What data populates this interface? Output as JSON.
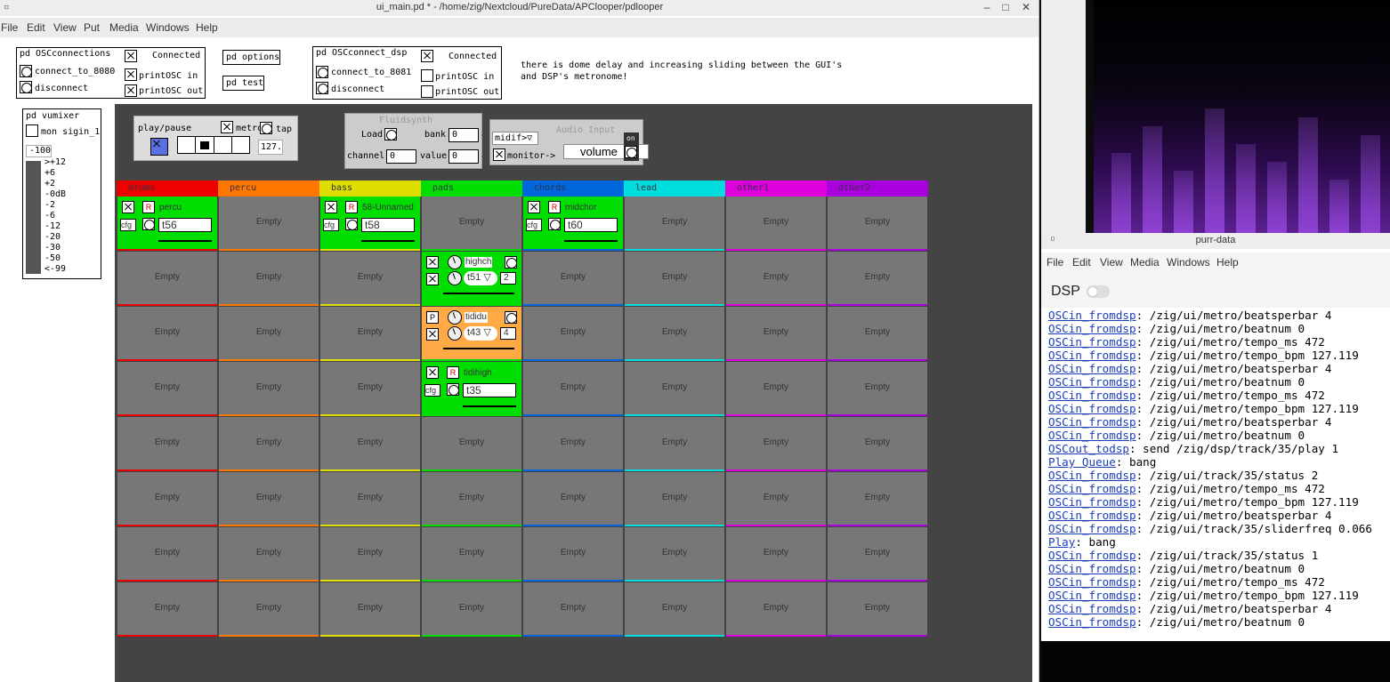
{
  "main_window": {
    "title": "ui_main.pd * - /home/zig/Nextcloud/PureData/APClooper/pdlooper",
    "menu": [
      "File",
      "Edit",
      "View",
      "Put",
      "Media",
      "Windows",
      "Help"
    ]
  },
  "osc_connections": {
    "name": "pd OSCconnections",
    "status": "Connected",
    "connect": "connect_to_8080",
    "disconnect": "disconnect",
    "print_in": "printOSC in",
    "print_out": "printOSC out"
  },
  "osc_connect_dsp": {
    "name": "pd OSCconnect_dsp",
    "status": "Connected",
    "connect": "connect_to_8081",
    "disconnect": "disconnect",
    "print_in": "printOSC in",
    "print_out": "printOSC out"
  },
  "options": {
    "options": "pd options",
    "test": "pd test"
  },
  "comment": "there is dome delay and increasing sliding between the GUI's\nand DSP's metronome!",
  "vumixer": {
    "name": "pd vumixer",
    "mon": "mon sigin_1",
    "value": "-100",
    "scale": [
      ">+12",
      "+6",
      "+2",
      "-0dB",
      "-2",
      "-6",
      "-12",
      "-20",
      "-30",
      "-50",
      "<-99"
    ]
  },
  "transport": {
    "play": "play/pause",
    "metro": "metro",
    "tap": "tap",
    "tempo": "127."
  },
  "fluidsynth": {
    "title": "Fluidsynth",
    "load": "Load",
    "bank": "bank",
    "bank_val": "0",
    "channel": "channel",
    "channel_val": "0",
    "value": "value",
    "value_val": "0"
  },
  "audio_input": {
    "title": "Audio Input",
    "midif": "midif>",
    "monitor": "monitor->",
    "volume": "volume",
    "on": "on"
  },
  "tracks": [
    {
      "name": "drums",
      "color": "#ee0000",
      "line": "#ee0000"
    },
    {
      "name": "percu",
      "color": "#ff7700",
      "line": "#ff7700"
    },
    {
      "name": "bass",
      "color": "#dddd00",
      "line": "#dddd00"
    },
    {
      "name": "pads",
      "color": "#00dd00",
      "line": "#00dd00"
    },
    {
      "name": "chords",
      "color": "#0066dd",
      "line": "#0066dd"
    },
    {
      "name": "lead",
      "color": "#00dddd",
      "line": "#00dddd"
    },
    {
      "name": "other1",
      "color": "#dd00dd",
      "line": "#dd00dd"
    },
    {
      "name": "other2",
      "color": "#aa00dd",
      "line": "#aa00dd"
    }
  ],
  "empty_label": "Empty",
  "clips": {
    "drums": {
      "name": "percu",
      "cfg": "cfg",
      "time": "t56"
    },
    "bass": {
      "name": "58-Unnamed",
      "cfg": "cfg",
      "time": "t58"
    },
    "chords": {
      "name": "midchor",
      "cfg": "cfg",
      "time": "t60"
    },
    "pads1": {
      "name": "highch",
      "time": "t51",
      "count": "2",
      "knobval": "1.2"
    },
    "pads2": {
      "name": "tididu",
      "p": "P",
      "time": "t43",
      "count": "4",
      "knobval": "1.2"
    },
    "pads3": {
      "name": "tidihigh",
      "cfg": "cfg",
      "time": "t35"
    }
  },
  "purr": {
    "title": "purr-data",
    "menu": [
      "File",
      "Edit",
      "View",
      "Media",
      "Windows",
      "Help"
    ],
    "dsp": "DSP",
    "log": [
      {
        "k": "OSCin_fromdsp",
        "v": ": /zig/ui/metro/beatsperbar 4"
      },
      {
        "k": "OSCin_fromdsp",
        "v": ": /zig/ui/metro/beatnum 0"
      },
      {
        "k": "OSCin_fromdsp",
        "v": ": /zig/ui/metro/tempo_ms 472"
      },
      {
        "k": "OSCin_fromdsp",
        "v": ": /zig/ui/metro/tempo_bpm 127.119"
      },
      {
        "k": "OSCin_fromdsp",
        "v": ": /zig/ui/metro/beatsperbar 4"
      },
      {
        "k": "OSCin_fromdsp",
        "v": ": /zig/ui/metro/beatnum 0"
      },
      {
        "k": "OSCin_fromdsp",
        "v": ": /zig/ui/metro/tempo_ms 472"
      },
      {
        "k": "OSCin_fromdsp",
        "v": ": /zig/ui/metro/tempo_bpm 127.119"
      },
      {
        "k": "OSCin_fromdsp",
        "v": ": /zig/ui/metro/beatsperbar 4"
      },
      {
        "k": "OSCin_fromdsp",
        "v": ": /zig/ui/metro/beatnum 0"
      },
      {
        "k": "OSCout_todsp",
        "v": ": send /zig/dsp/track/35/play 1"
      },
      {
        "k": "Play Queue",
        "v": ": bang"
      },
      {
        "k": "OSCin_fromdsp",
        "v": ": /zig/ui/track/35/status 2"
      },
      {
        "k": "OSCin_fromdsp",
        "v": ": /zig/ui/metro/tempo_ms 472"
      },
      {
        "k": "OSCin_fromdsp",
        "v": ": /zig/ui/metro/tempo_bpm 127.119"
      },
      {
        "k": "OSCin_fromdsp",
        "v": ": /zig/ui/metro/beatsperbar 4"
      },
      {
        "k": "OSCin_fromdsp",
        "v": ": /zig/ui/track/35/sliderfreq 0.066"
      },
      {
        "k": "Play",
        "v": ": bang"
      },
      {
        "k": "OSCin_fromdsp",
        "v": ": /zig/ui/track/35/status 1"
      },
      {
        "k": "OSCin_fromdsp",
        "v": ": /zig/ui/metro/beatnum 0"
      },
      {
        "k": "OSCin_fromdsp",
        "v": ": /zig/ui/metro/tempo_ms 472"
      },
      {
        "k": "OSCin_fromdsp",
        "v": ": /zig/ui/metro/tempo_bpm 127.119"
      },
      {
        "k": "OSCin_fromdsp",
        "v": ": /zig/ui/metro/beatsperbar 4"
      },
      {
        "k": "OSCin_fromdsp",
        "v": ": /zig/ui/metro/beatnum 0"
      }
    ]
  }
}
